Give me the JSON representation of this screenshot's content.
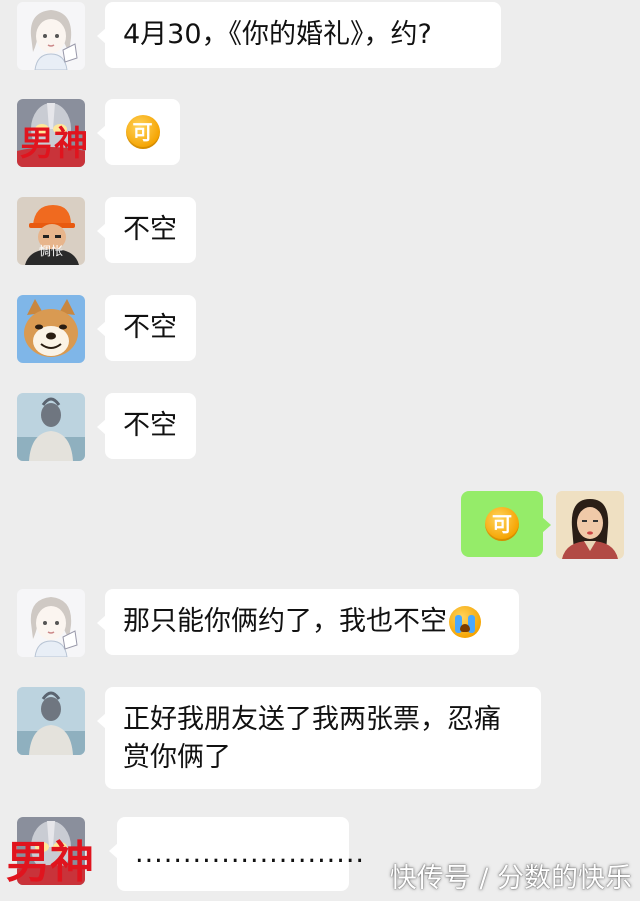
{
  "messages": [
    {
      "sender": "girl-sketch",
      "text": "4月30，《你的婚礼》，约?"
    },
    {
      "sender": "nanshen",
      "badge": "男神",
      "emoji": "可"
    },
    {
      "sender": "worker-helmet",
      "avatar_caption": "惆怅",
      "text": "不空"
    },
    {
      "sender": "shiba-dog",
      "text": "不空"
    },
    {
      "sender": "statue",
      "text": "不空"
    },
    {
      "sender": "self",
      "emoji": "可"
    },
    {
      "sender": "girl-sketch",
      "text": "那只能你俩约了，我也不空"
    },
    {
      "sender": "statue",
      "text_line1": "正好我朋友送了我两张票，忍痛",
      "text_line2": "赏你俩了"
    },
    {
      "sender": "nanshen",
      "badge": "男神",
      "text": "........................"
    }
  ],
  "watermark": "快传号 / 分数的快乐",
  "colors": {
    "background": "#ededed",
    "bubble_other": "#ffffff",
    "bubble_self": "#95ec69",
    "badge_red": "#e0141e"
  }
}
